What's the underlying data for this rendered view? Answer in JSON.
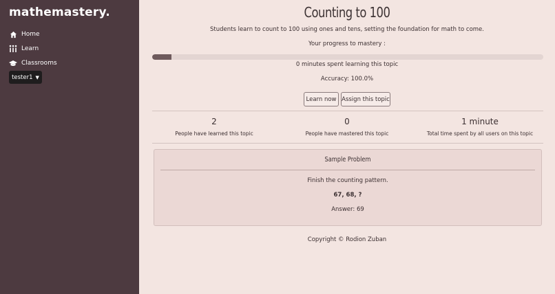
{
  "sidebar": {
    "brand": "mathemastery.",
    "items": [
      {
        "label": "Home",
        "icon": "home-icon"
      },
      {
        "label": "Learn",
        "icon": "learn-icon"
      },
      {
        "label": "Classrooms",
        "icon": "graduation-cap-icon"
      }
    ],
    "user_dropdown": "tester1"
  },
  "topic": {
    "title": "Counting to 100",
    "description": "Students learn to count to 100 using ones and tens, setting the foundation for math to come.",
    "progress_label": "Your progress to mastery :",
    "progress_fraction": 0.05,
    "time_spent": "0 minutes spent learning this topic",
    "accuracy": "Accuracy: 100.0%"
  },
  "buttons": {
    "learn_now": "Learn now",
    "assign": "Assign this topic"
  },
  "stats": [
    {
      "value": "2",
      "label": "People have learned this topic"
    },
    {
      "value": "0",
      "label": "People have mastered this topic"
    },
    {
      "value": "1 minute",
      "label": "Total time spent by all users on this topic"
    }
  ],
  "sample": {
    "heading": "Sample Problem",
    "prompt": "Finish the counting pattern.",
    "problem": "67, 68, ?",
    "answer": "Answer: 69"
  },
  "footer": "Copyright © Rodion Zuban",
  "colors": {
    "sidebar_bg": "#4d3a40",
    "page_bg": "#f3e5e1",
    "progress_fill": "#6e5a5c",
    "card_bg": "#ebd8d5"
  }
}
